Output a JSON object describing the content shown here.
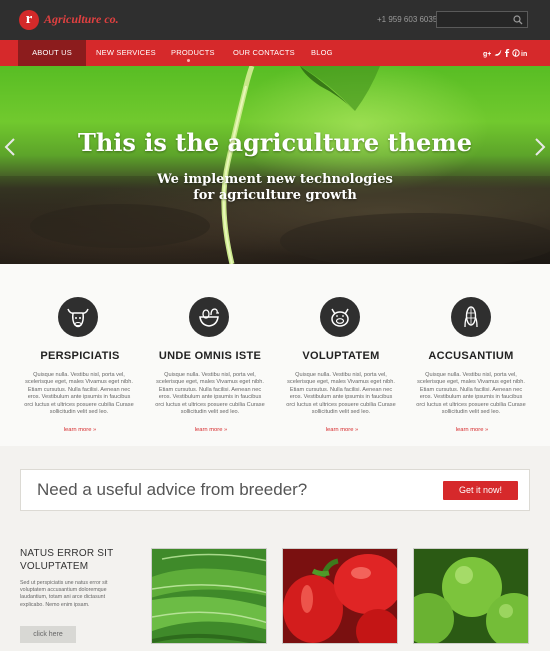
{
  "header": {
    "logo_letter": "r",
    "logo_text": "Agriculture co.",
    "phone": "+1 959 603 6035",
    "search_placeholder": ""
  },
  "nav": {
    "items": [
      {
        "label": "ABOUT US",
        "active": true
      },
      {
        "label": "NEW SERVICES",
        "active": false
      },
      {
        "label": "PRODUCTS",
        "active": false
      },
      {
        "label": "OUR CONTACTS",
        "active": false
      },
      {
        "label": "BLOG",
        "active": false
      }
    ],
    "social_icons": [
      "google-plus-icon",
      "twitter-icon",
      "facebook-icon",
      "pinterest-icon",
      "linkedin-icon"
    ]
  },
  "hero": {
    "title": "This is the agriculture theme",
    "subtitle_line1": "We implement new technologies",
    "subtitle_line2": "for agriculture growth"
  },
  "features": [
    {
      "icon": "bull-head-icon",
      "title": "PERSPICIATIS",
      "text": "Quisque nulla. Vestibu nisl, porta vel, scelerisque eget, males Vivamus eget nibh. Etiam cursutus. Nulla facilisi. Aenean nec eros. Vestibulum ante ipsumis in faucibus orci luctus et ultrices posuere cubilia Curase sollicitudin velit sed leo.",
      "link": "learn more"
    },
    {
      "icon": "chicken-eggs-icon",
      "title": "UNDE OMNIS ISTE",
      "text": "Quisque nulla. Vestibu nisl, porta vel, scelerisque eget, males Vivamus eget nibh. Etiam cursutus. Nulla facilisi. Aenean nec eros. Vestibulum ante ipsumis in faucibus orci luctus et ultrices posuere cubilia Curase sollicitudin velit sed leo.",
      "link": "learn more"
    },
    {
      "icon": "pig-head-icon",
      "title": "VOLUPTATEM",
      "text": "Quisque nulla. Vestibu nisl, porta vel, scelerisque eget, males Vivamus eget nibh. Etiam cursutus. Nulla facilisi. Aenean nec eros. Vestibulum ante ipsumis in faucibus orci luctus et ultrices posuere cubilia Curase sollicitudin velit sed leo.",
      "link": "learn more"
    },
    {
      "icon": "corn-icon",
      "title": "ACCUSANTIUM",
      "text": "Quisque nulla. Vestibu nisl, porta vel, scelerisque eget, males Vivamus eget nibh. Etiam cursutus. Nulla facilisi. Aenean nec eros. Vestibulum ante ipsumis in faucibus orci luctus et ultrices posuere cubilia Curase sollicitudin velit sed leo.",
      "link": "learn more"
    }
  ],
  "banner": {
    "text": "Need a useful advice from breeder?",
    "button": "Get it now!"
  },
  "bottom": {
    "title": "NATUS ERROR SIT VOLUPTATEM",
    "text": "Sed ut perspiciatis une natus error sit voluptatem accusantium doloremque laudantium, totam ani arce dictasunt explicabo. Nemo enim ipsam.",
    "button": "click here",
    "photos": [
      "spinach-photo",
      "red-peppers-photo",
      "green-apples-photo"
    ]
  },
  "colors": {
    "accent": "#d6292b",
    "topbar": "#2f2f2f",
    "active_nav": "#8c1c1d"
  }
}
